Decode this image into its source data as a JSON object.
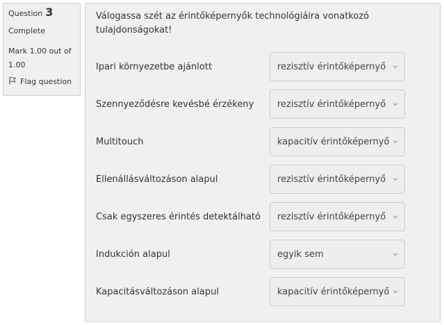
{
  "info": {
    "question_prefix": "Question",
    "question_number": "3",
    "state": "Complete",
    "grade": "Mark 1.00 out of 1.00",
    "flag_label": "Flag question"
  },
  "question": {
    "text": "Válogassa szét az érintőképernyők technológiáira vonatkozó tulajdonságokat!",
    "rows": [
      {
        "label": "Ipari környezetbe ajánlott",
        "selected": "rezisztív érintőképernyő"
      },
      {
        "label": "Szennyeződésre kevésbé érzékeny",
        "selected": "rezisztív érintőképernyő"
      },
      {
        "label": "Multitouch",
        "selected": "kapacitív érintőképernyő"
      },
      {
        "label": "Ellenállásváltozáson alapul",
        "selected": "rezisztív érintőképernyő"
      },
      {
        "label": "Csak egyszeres érintés detektálható",
        "selected": "rezisztív érintőképernyő"
      },
      {
        "label": "Indukción alapul",
        "selected": "egyik sem"
      },
      {
        "label": "Kapacitásváltozáson alapul",
        "selected": "kapacitív érintőképernyő"
      }
    ]
  }
}
